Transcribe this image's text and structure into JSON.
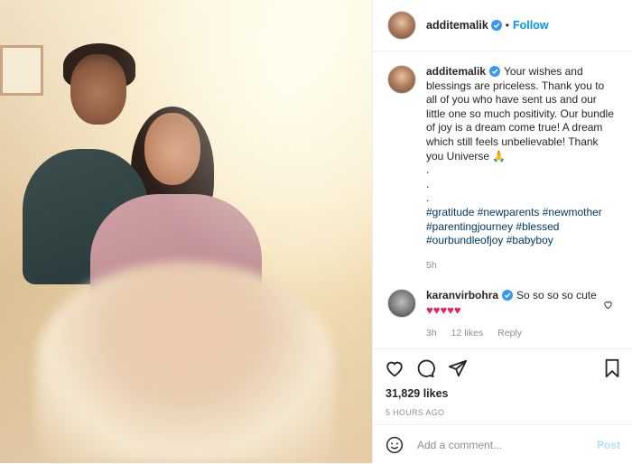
{
  "photo": {
    "alt_icon": "photo"
  },
  "header": {
    "username": "additemalik",
    "separator": "•",
    "follow_label": "Follow"
  },
  "caption": {
    "username": "additemalik",
    "text": "Your wishes and blessings are priceless. Thank you to all of you who have sent us and our little one so much positivity. Our bundle of joy is a dream come true! A dream which still feels unbelievable! Thank you Universe 🙏",
    "dots": [
      ".",
      ".",
      "."
    ],
    "hashtags": "#gratitude #newparents #newmother #parentingjourney #blessed #ourbundleofjoy #babyboy",
    "time": "5h"
  },
  "comment": {
    "username": "karanvirbohra",
    "text": "So so so so cute",
    "hearts": "♥♥♥♥♥",
    "time": "3h",
    "likes": "12 likes",
    "reply_label": "Reply"
  },
  "actions": {
    "likes": "31,829 likes",
    "ago": "5 HOURS AGO"
  },
  "add_comment": {
    "placeholder": "Add a comment...",
    "post_label": "Post"
  },
  "colors": {
    "accent": "#0095f6",
    "post_disabled": "#b2dffc",
    "hashtag": "#00376b",
    "heart": "#e0245e"
  }
}
